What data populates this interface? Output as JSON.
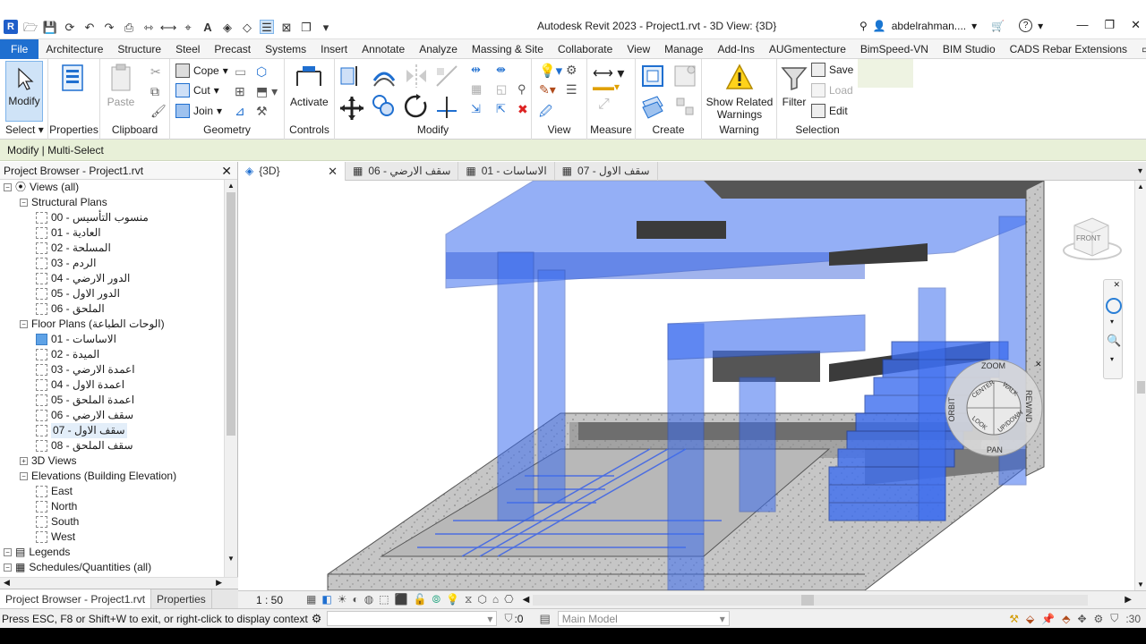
{
  "app": {
    "title": "Autodesk Revit 2023 - Project1.rvt - 3D View: {3D}",
    "user": "abdelrahman....",
    "help": "?"
  },
  "tabs": [
    "File",
    "Architecture",
    "Structure",
    "Steel",
    "Precast",
    "Systems",
    "Insert",
    "Annotate",
    "Analyze",
    "Massing & Site",
    "Collaborate",
    "View",
    "Manage",
    "Add-Ins",
    "AUGmentecture",
    "BimSpeed-VN",
    "BIM Studio",
    "CADS Rebar Extensions"
  ],
  "ribbon": {
    "modify_label": "Modify",
    "select_label": "Select",
    "properties_label": "Properties",
    "paste_label": "Paste",
    "clipboard_label": "Clipboard",
    "cope_label": "Cope",
    "cut_label": "Cut",
    "join_label": "Join",
    "geometry_label": "Geometry",
    "activate_label": "Activate",
    "controls_label": "Controls",
    "modify_panel_label": "Modify",
    "view_panel_label": "View",
    "measure_label": "Measure",
    "create_label": "Create",
    "show_related_warnings": "Show Related Warnings",
    "warning_label": "Warning",
    "filter_label": "Filter",
    "save_label": "Save",
    "load_label": "Load",
    "edit_label": "Edit",
    "selection_label": "Selection"
  },
  "option_bar": "Modify | Multi-Select",
  "project_browser": {
    "title": "Project Browser - Project1.rvt",
    "views_all": "Views (all)",
    "structural_plans": "Structural Plans",
    "structural_items": [
      "00 - منسوب التأسيس",
      "01 - العادية",
      "02 - المسلحة",
      "03 - الردم",
      "04 - الدور الارضي",
      "05 - الدور الاول",
      "06 - الملحق"
    ],
    "floor_plans": "Floor Plans (الوحات الطباعة)",
    "floor_items": [
      "01 - الاساسات",
      "02 - الميدة",
      "03 - اعمدة الارضي",
      "04 - اعمدة الاول",
      "05 - اعمدة الملحق",
      "06 - سقف الارضي",
      "07 - سقف الاول",
      "08 - سقف الملحق"
    ],
    "views_3d": "3D Views",
    "elevations": "Elevations (Building Elevation)",
    "elevation_items": [
      "East",
      "North",
      "South",
      "West"
    ],
    "legends": "Legends",
    "schedules": "Schedules/Quantities (all)",
    "bottom_tabs": [
      "Project Browser - Project1.rvt",
      "Properties"
    ]
  },
  "view_tabs": [
    "{3D}",
    "06 - سقف الارضي",
    "01 - الاساسات",
    "07 - سقف الاول"
  ],
  "viewcube": {
    "face": "FRONT"
  },
  "wheel": {
    "zoom": "ZOOM",
    "rewind": "REWIND",
    "pan": "PAN",
    "orbit": "ORBIT",
    "center": "CENTER",
    "walk": "WALK",
    "look": "LOOK",
    "updown": "UP/DOWN"
  },
  "view_bar": {
    "scale": "1 : 50"
  },
  "status": {
    "message": "Press ESC, F8 or Shift+W to exit, or right-click to display context",
    "count": ":0",
    "model": "Main Model",
    "filter_count": ":30"
  },
  "colors": {
    "accent": "#1f6fd0",
    "selection_blue": "#3d6ef0",
    "concrete": "#8a8a8a",
    "option_bar": "#e8f0d8"
  }
}
